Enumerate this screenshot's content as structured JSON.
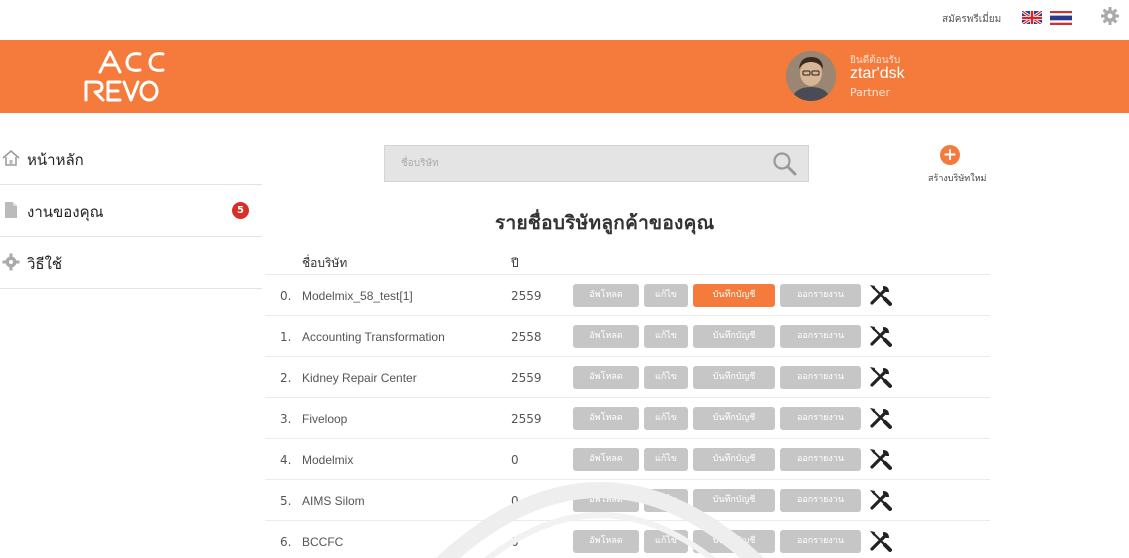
{
  "topbar": {
    "premium_link": "สมัครพรีเมี่ยม",
    "icons": [
      "uk-flag-icon",
      "thai-flag-icon",
      "gear-icon"
    ]
  },
  "header": {
    "logo_text": "ACC REVO",
    "welcome": "ยินดีต้อนรับ",
    "username": "ztar'dsk",
    "role": "Partner",
    "accent_color": "#f47b3c"
  },
  "sidebar": {
    "items": [
      {
        "label": "หน้าหลัก",
        "icon": "home-icon"
      },
      {
        "label": "งานของคุณ",
        "icon": "document-icon",
        "badge": "5"
      },
      {
        "label": "วิธีใช้",
        "icon": "gear-icon"
      }
    ]
  },
  "search": {
    "placeholder": "ชื่อบริษัท",
    "icon": "search-icon"
  },
  "create": {
    "label": "สร้างบริษัทใหม่",
    "icon": "plus-circle-icon"
  },
  "list": {
    "title": "รายชื่อบริษัทลูกค้าของคุณ",
    "headers": {
      "name": "ชื่อบริษัท",
      "year": "ปี"
    },
    "buttons": {
      "upload": "อัพโหลด",
      "edit": "แก้ไข",
      "record": "บันทึกบัญชี",
      "report": "ออกรายงาน"
    },
    "rows": [
      {
        "num": "0.",
        "name": "Modelmix_58_test[1]",
        "year": "2559",
        "record_active": true
      },
      {
        "num": "1.",
        "name": "Accounting Transformation",
        "year": "2558",
        "record_active": false
      },
      {
        "num": "2.",
        "name": "Kidney Repair Center",
        "year": "2559",
        "record_active": false
      },
      {
        "num": "3.",
        "name": "Fiveloop",
        "year": "2559",
        "record_active": false
      },
      {
        "num": "4.",
        "name": "Modelmix",
        "year": "0",
        "record_active": false
      },
      {
        "num": "5.",
        "name": "AIMS Silom",
        "year": "0",
        "record_active": false
      },
      {
        "num": "6.",
        "name": "BCCFC",
        "year": "0",
        "record_active": false
      }
    ]
  }
}
